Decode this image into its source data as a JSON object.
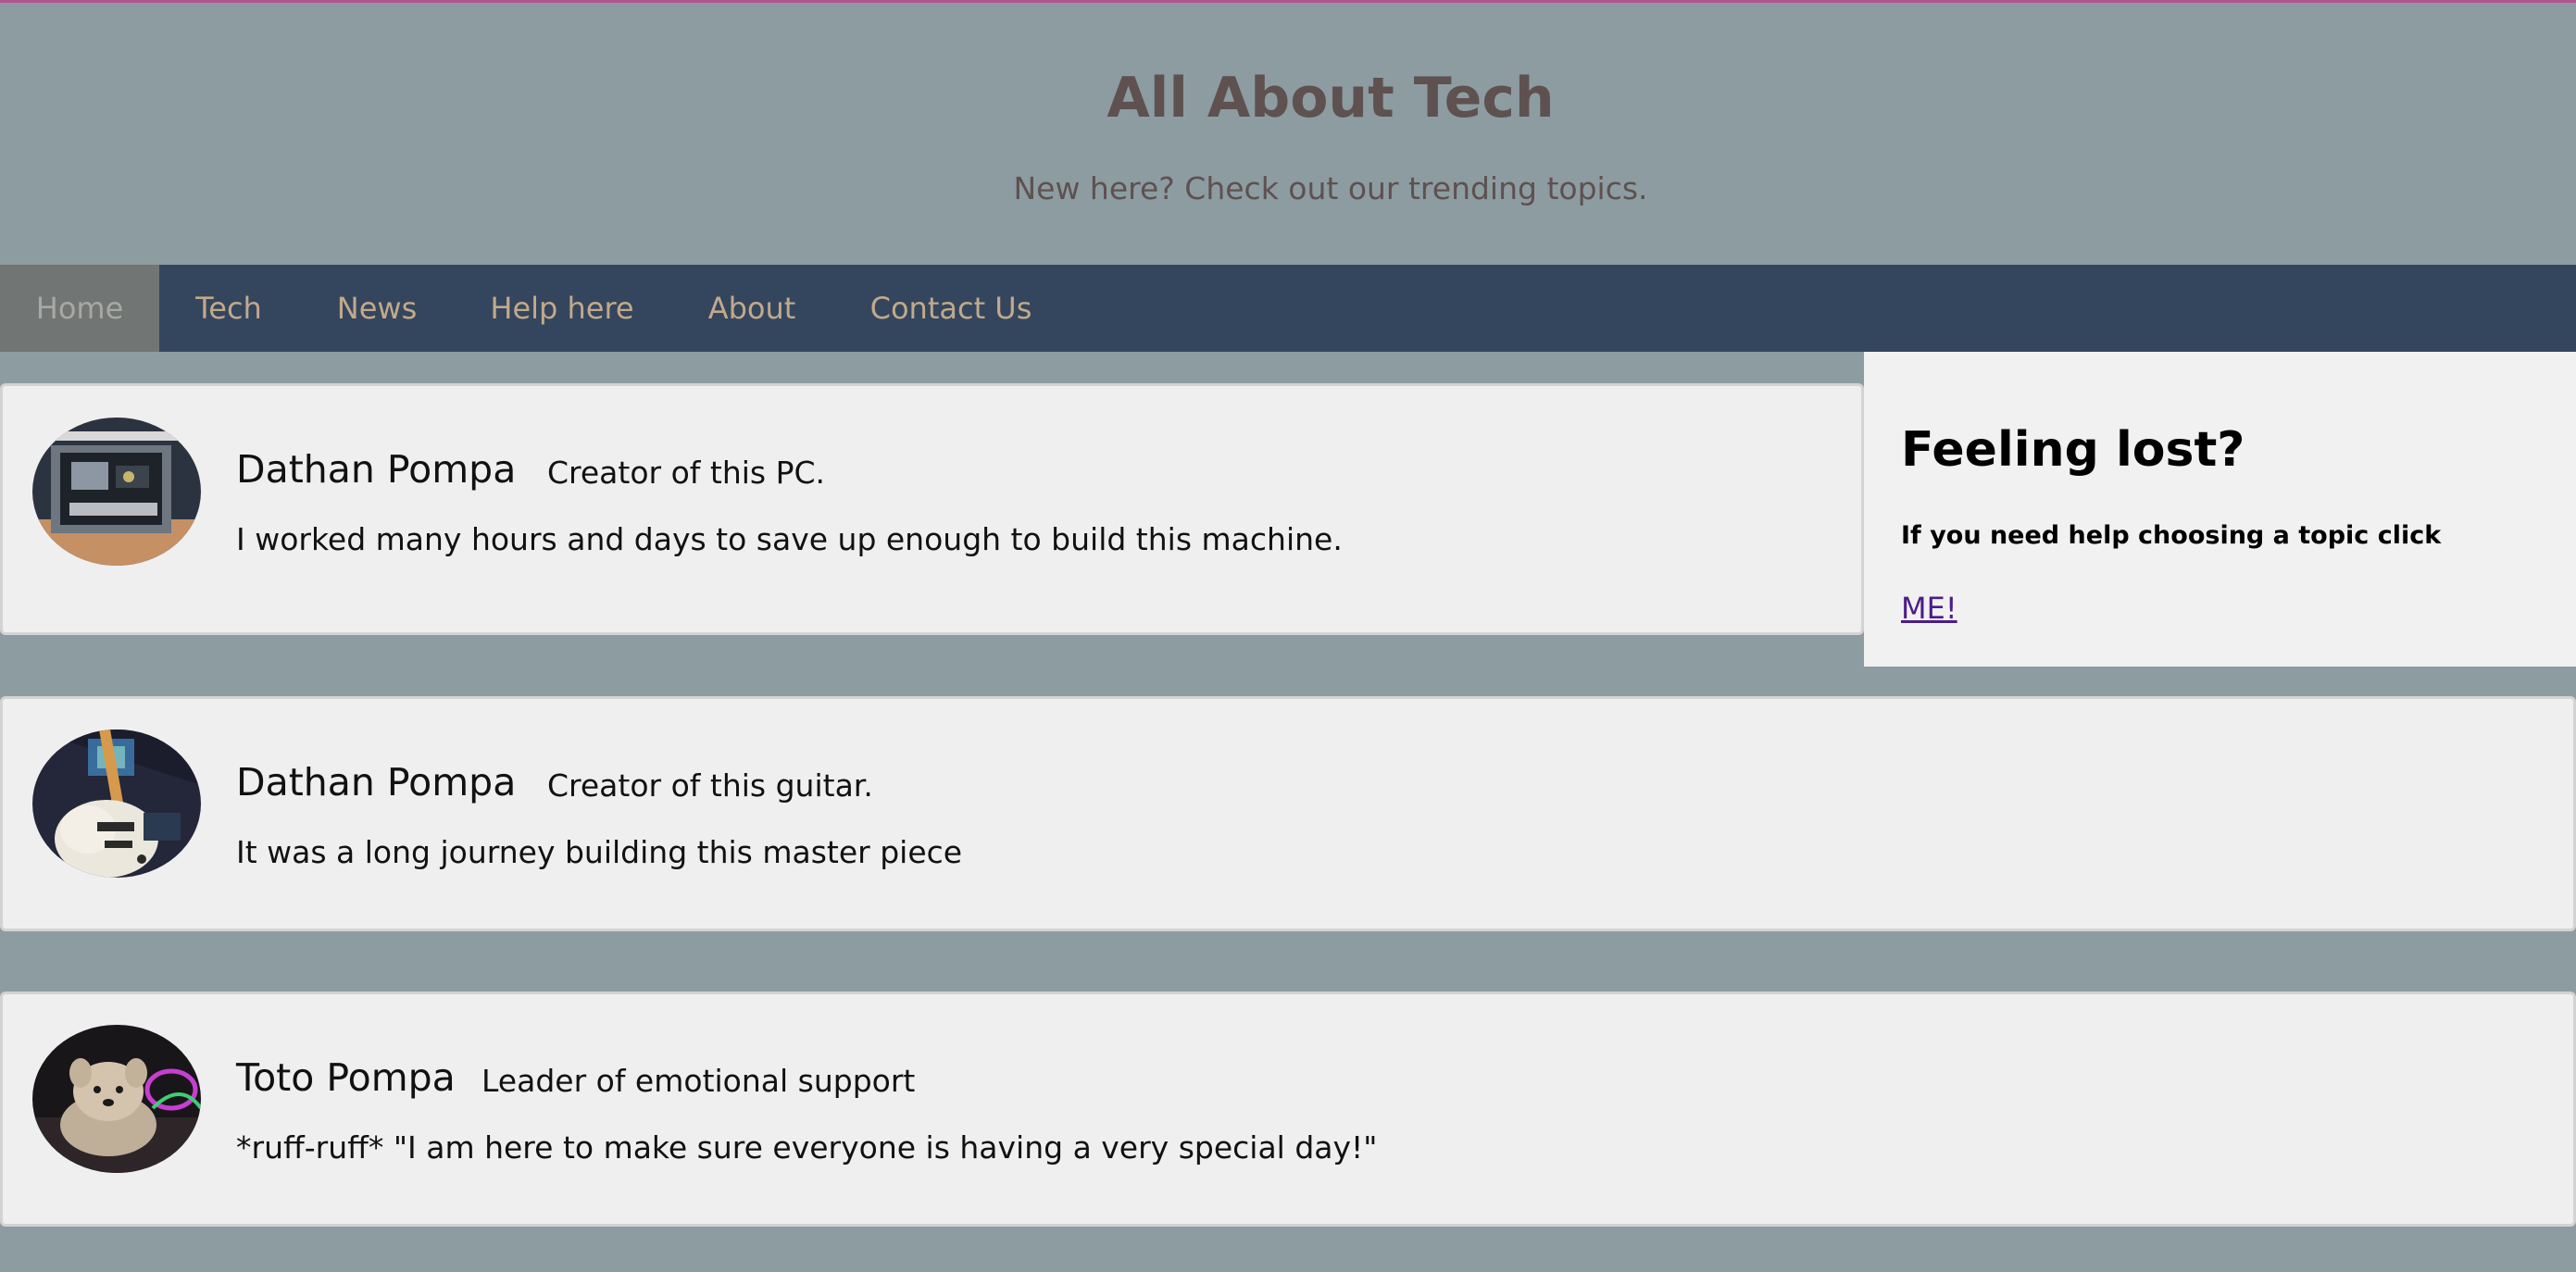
{
  "header": {
    "title": "All About Tech",
    "subtitle": "New here? Check out our trending topics."
  },
  "nav": {
    "items": [
      {
        "label": "Home",
        "active": true
      },
      {
        "label": "Tech",
        "active": false
      },
      {
        "label": "News",
        "active": false
      },
      {
        "label": "Help here",
        "active": false
      },
      {
        "label": "About",
        "active": false
      },
      {
        "label": "Contact Us",
        "active": false
      }
    ]
  },
  "cards": [
    {
      "name": "Dathan Pompa",
      "role": "Creator of this PC.",
      "text": "I worked many hours and days to save up enough to build this machine.",
      "image": "pc-build-photo"
    },
    {
      "name": "Dathan Pompa",
      "role": "Creator of this guitar.",
      "text": "It was a long journey building this master piece",
      "image": "guitar-photo"
    },
    {
      "name": "Toto Pompa",
      "role": "Leader of emotional support",
      "text": "*ruff-ruff* \"I am here to make sure everyone is having a very special day!\"",
      "image": "dog-photo"
    }
  ],
  "sidebar": {
    "title": "Feeling lost?",
    "text": "If you need help choosing a topic click",
    "link_label": "ME!"
  },
  "colors": {
    "background": "#8d9ca1",
    "nav_background": "#34465e",
    "nav_text": "#c2a98a",
    "nav_active": "#717573",
    "title_text": "#5e5150",
    "card_background": "#efefef",
    "link": "#4b1d8a"
  }
}
